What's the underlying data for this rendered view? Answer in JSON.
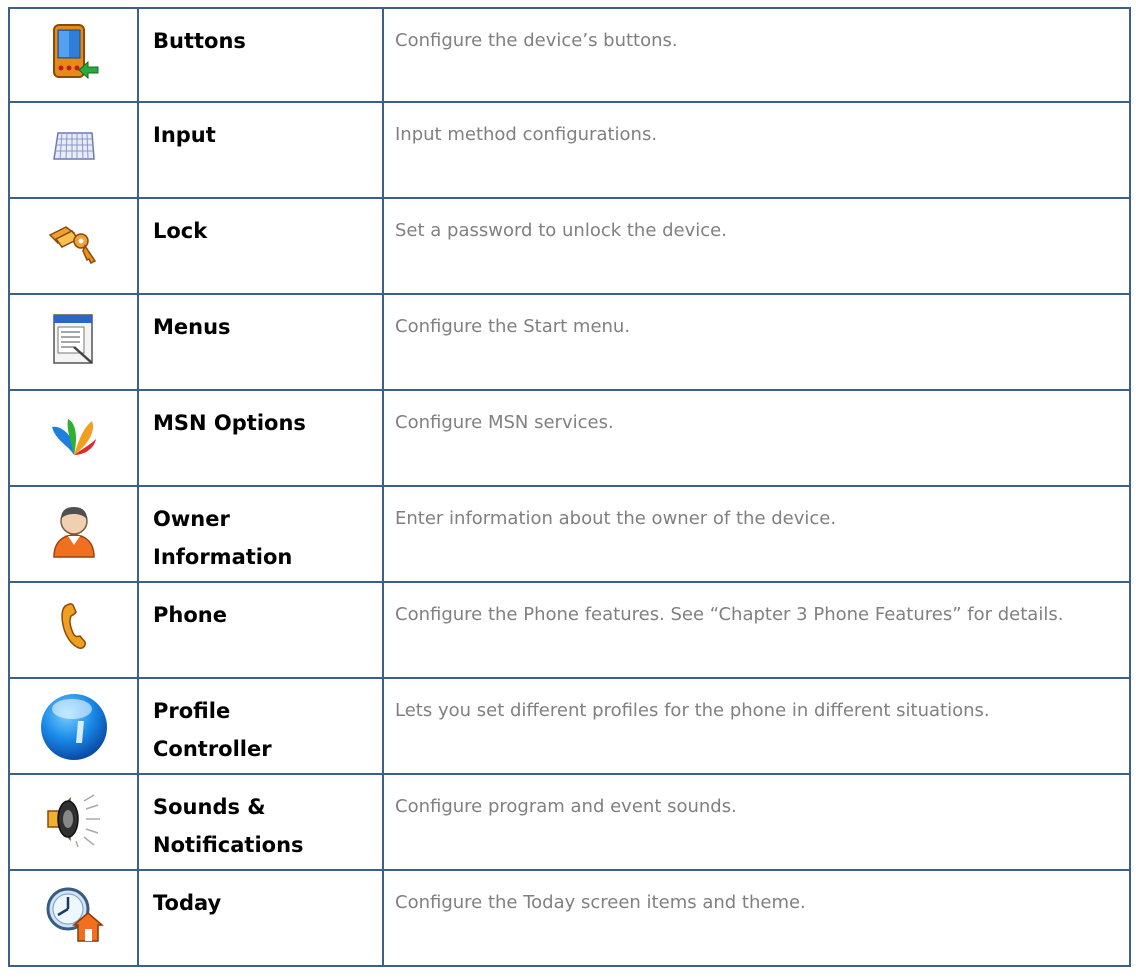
{
  "rows": [
    {
      "icon": "pda-buttons-icon",
      "name": "Buttons",
      "description": "Configure the device’s buttons."
    },
    {
      "icon": "keyboard-icon",
      "name": "Input",
      "description": "Input method configurations."
    },
    {
      "icon": "lock-keys-icon",
      "name": "Lock",
      "description": "Set a password to unlock the device."
    },
    {
      "icon": "menu-window-icon",
      "name": "Menus",
      "description": "Configure the Start menu."
    },
    {
      "icon": "msn-butterfly-icon",
      "name": "MSN Options",
      "description": "Configure MSN services."
    },
    {
      "icon": "owner-person-icon",
      "name": "Owner\nInformation",
      "description": "Enter information about the owner of the device."
    },
    {
      "icon": "phone-handset-icon",
      "name": "Phone",
      "description": "Configure the Phone features. See “Chapter 3 Phone Features” for details."
    },
    {
      "icon": "blue-globe-icon",
      "name": "Profile\nController",
      "description": "Lets you set different profiles for the phone in different situations."
    },
    {
      "icon": "speaker-icon",
      "name": "Sounds &\nNotifications",
      "description": "Configure program and event sounds."
    },
    {
      "icon": "clock-home-icon",
      "name": "Today",
      "description": "Configure the Today screen items and theme."
    }
  ]
}
